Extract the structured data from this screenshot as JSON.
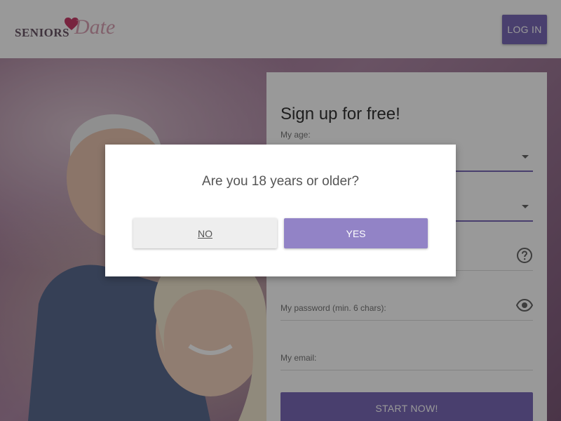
{
  "header": {
    "logo_text_1": "SENIORS",
    "logo_text_2": "Date",
    "logo_heart": "heart-icon",
    "login_label": "LOG IN"
  },
  "form": {
    "title": "Sign up for free!",
    "age_label": "My age:",
    "password_label": "My password (min. 6 chars):",
    "email_label": "My email:",
    "start_label": "START NOW!",
    "help_icon": "help-circle-icon",
    "eye_icon": "eye-icon"
  },
  "modal": {
    "question": "Are you 18 years or older?",
    "no_label": "NO",
    "yes_label": "YES"
  },
  "colors": {
    "accent": "#7b6ab8",
    "yes_button": "#9283c6",
    "no_button": "#eeeeee",
    "overlay": "rgba(0,0,0,0.4)"
  }
}
